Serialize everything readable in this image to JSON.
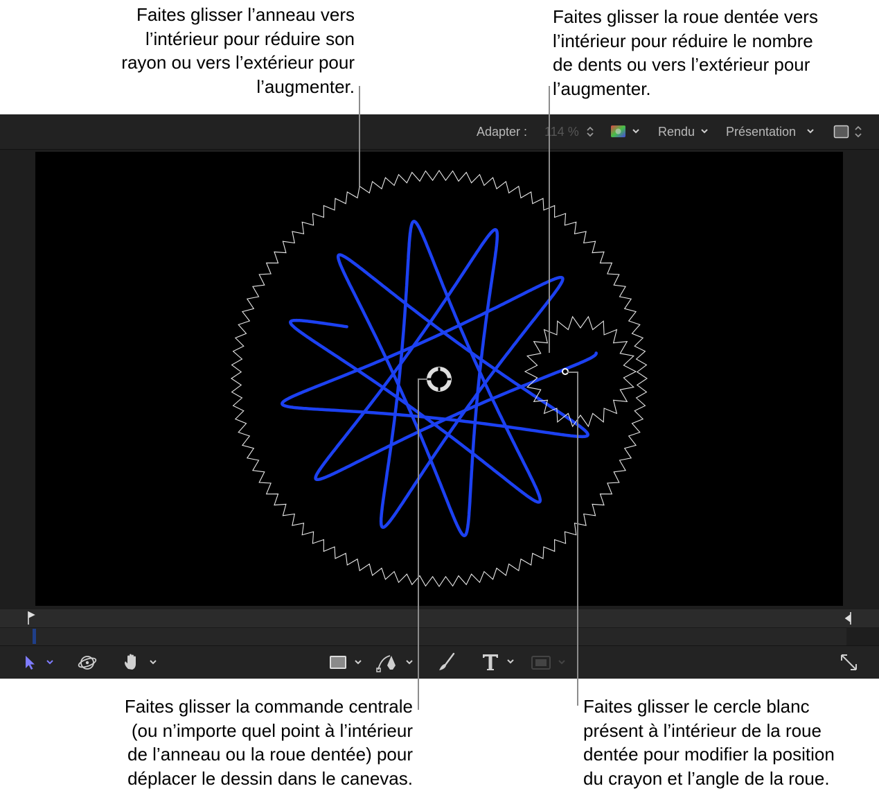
{
  "callouts": {
    "ring": "Faites glisser l’anneau vers\nl’intérieur pour réduire son\nrayon ou vers l’extérieur pour\nl’augmenter.",
    "wheel": "Faites glisser la roue dentée vers\nl’intérieur pour réduire le nombre\nde dents ou vers l’extérieur pour\nl’augmenter.",
    "center": "Faites glisser la commande centrale\n(ou n’importe quel point à l’intérieur\nde l’anneau ou la roue dentée) pour\ndéplacer le dessin dans le canevas.",
    "circle": "Faites glisser le cercle blanc\nprésent à l’intérieur de la roue\ndentée pour modifier la position\ndu crayon et l’angle de la roue."
  },
  "toolbar": {
    "fit_label": "Adapter :",
    "zoom_value": "114 %",
    "render_label": "Rendu",
    "view_label": "Présentation"
  },
  "tools": {
    "select_icon": "arrow-pointer-icon",
    "orbit_icon": "3d-orbit-icon",
    "pan_icon": "hand-icon",
    "shape_icon": "rectangle-icon",
    "pen_icon": "pen-tool-icon",
    "paint_icon": "paint-stroke-icon",
    "text_icon": "text-tool-icon",
    "mask_icon": "mask-icon",
    "fullscreen_icon": "expand-icon"
  },
  "colors": {
    "accent": "#7f7cff",
    "spiro": "#1e44ff",
    "gear": "#e8e8e8"
  }
}
